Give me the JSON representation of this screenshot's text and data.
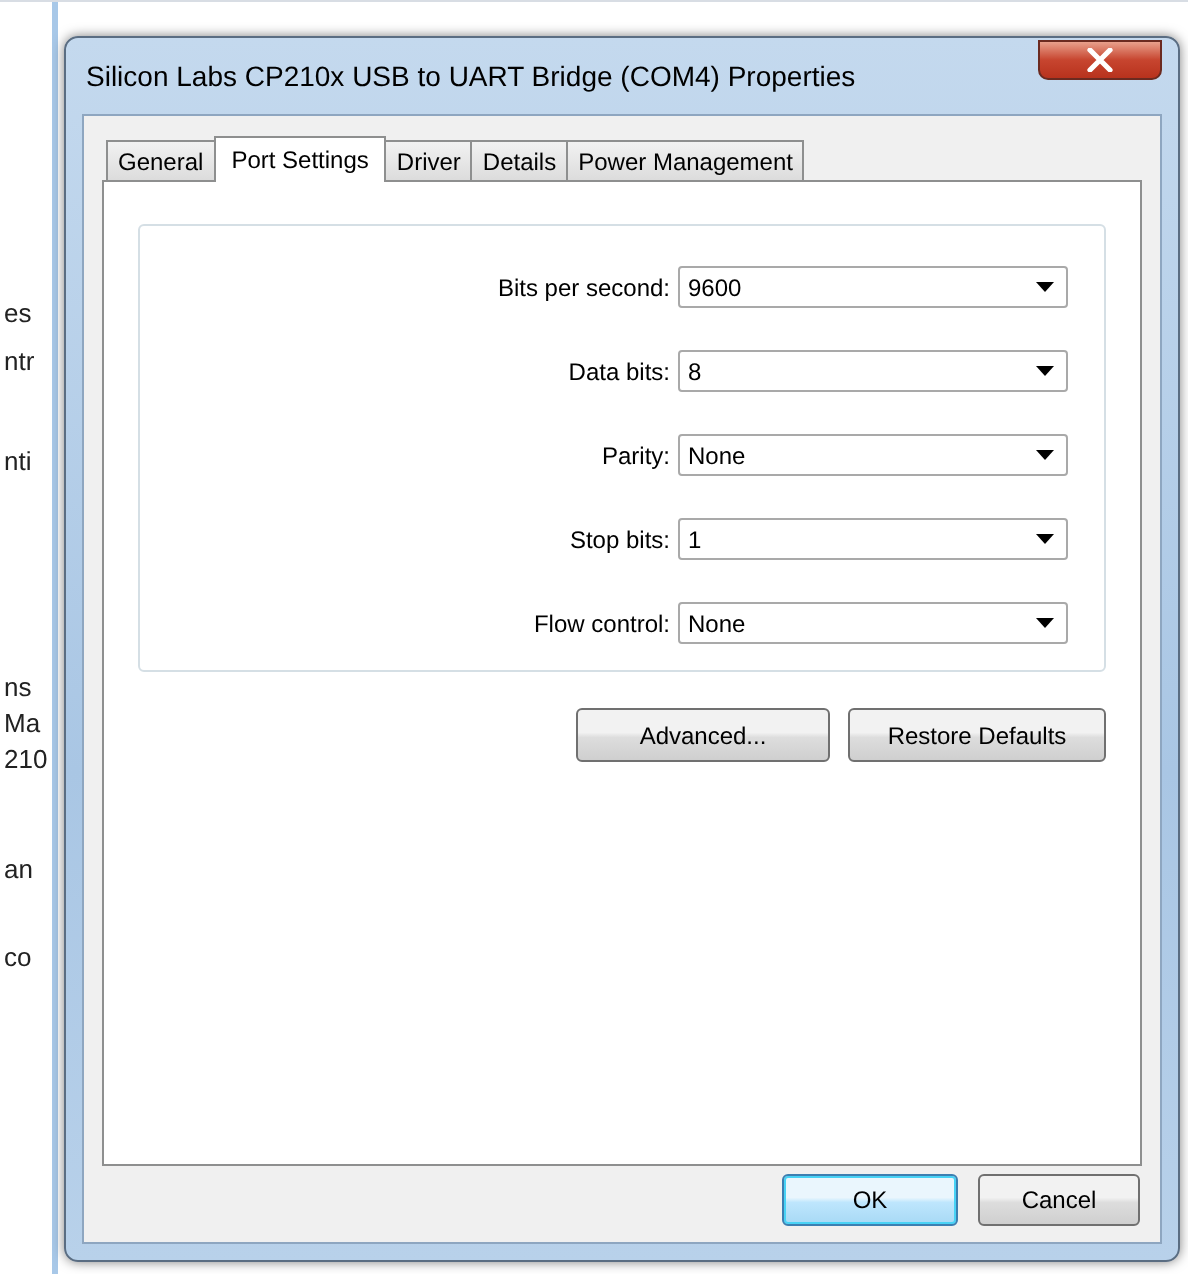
{
  "background_window": {
    "fragments": [
      "es",
      "ntr",
      "nti",
      "ns",
      "Ma",
      "210",
      "an",
      "co"
    ]
  },
  "window": {
    "title": "Silicon Labs CP210x USB to UART Bridge (COM4) Properties"
  },
  "tabs": [
    {
      "label": "General",
      "selected": false
    },
    {
      "label": "Port Settings",
      "selected": true
    },
    {
      "label": "Driver",
      "selected": false
    },
    {
      "label": "Details",
      "selected": false
    },
    {
      "label": "Power Management",
      "selected": false
    }
  ],
  "settings": [
    {
      "label": "Bits per second:",
      "value": "9600"
    },
    {
      "label": "Data bits:",
      "value": "8"
    },
    {
      "label": "Parity:",
      "value": "None"
    },
    {
      "label": "Stop bits:",
      "value": "1"
    },
    {
      "label": "Flow control:",
      "value": "None"
    }
  ],
  "page_buttons": [
    {
      "label": "Advanced...",
      "default": false
    },
    {
      "label": "Restore Defaults",
      "default": false
    }
  ],
  "dialog_buttons": [
    {
      "label": "OK",
      "default": true
    },
    {
      "label": "Cancel",
      "default": false
    }
  ]
}
